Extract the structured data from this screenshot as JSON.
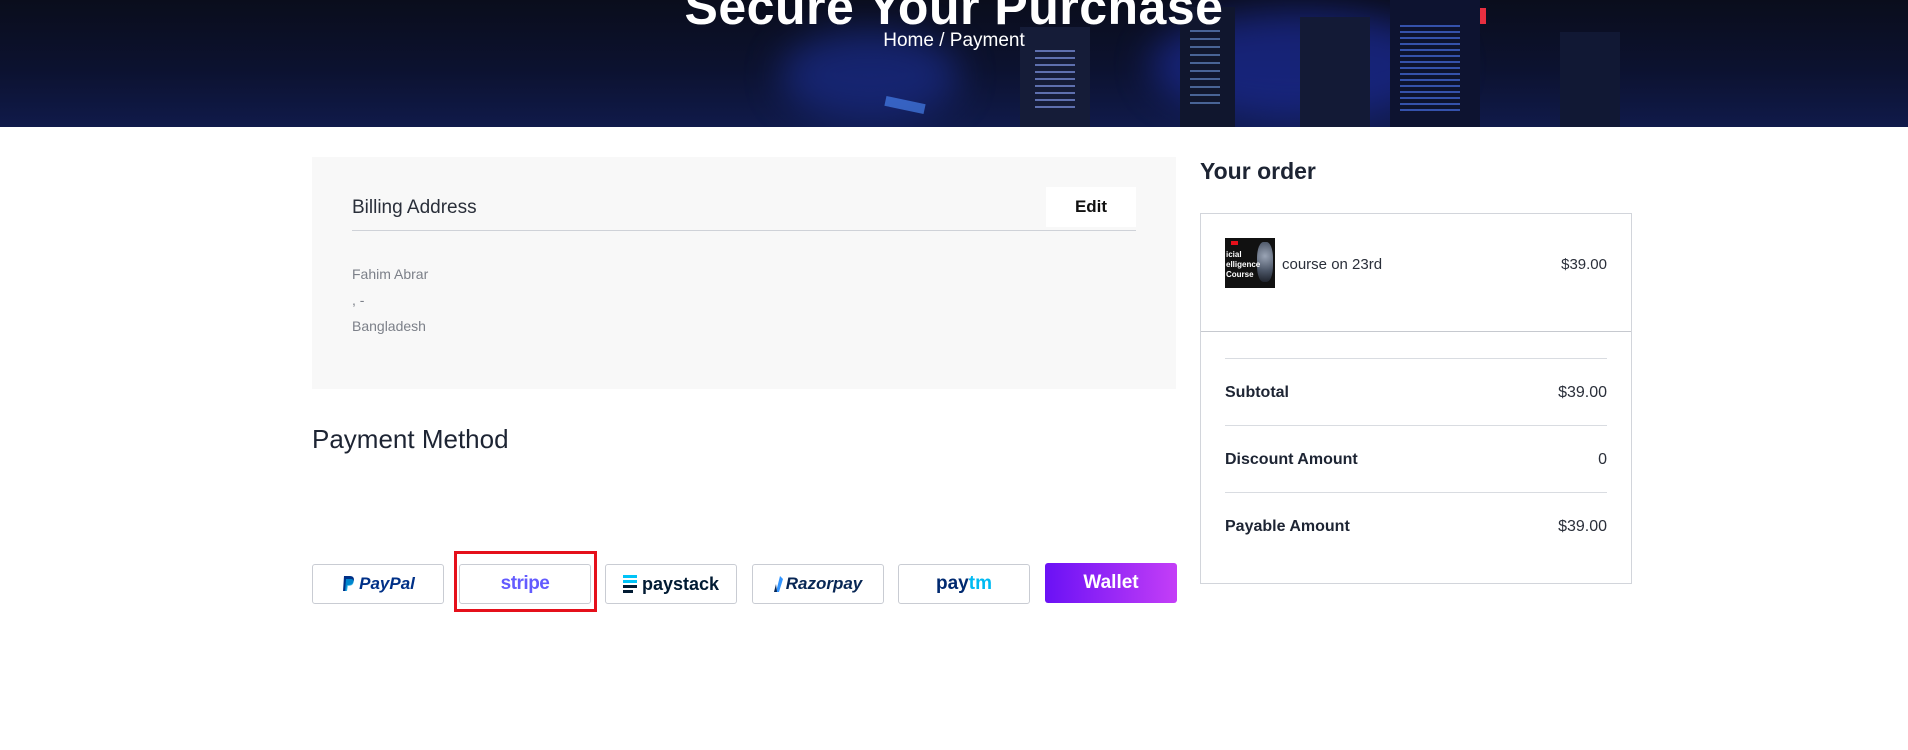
{
  "header": {
    "title": "Secure Your Purchase",
    "breadcrumb": "Home / Payment"
  },
  "billing": {
    "title": "Billing Address",
    "edit_label": "Edit",
    "name": "Fahim Abrar",
    "line2": ", -",
    "country": "Bangladesh"
  },
  "payment": {
    "title": "Payment Method",
    "methods": {
      "paypal": "PayPal",
      "stripe": "stripe",
      "paystack": "paystack",
      "razorpay": "Razorpay",
      "paytm": "paytm",
      "wallet": "Wallet"
    },
    "highlighted": "stripe"
  },
  "order": {
    "title": "Your order",
    "item": {
      "thumb_text": "icial\nelligence\nCourse",
      "name": "course on 23rd",
      "price": "$39.00"
    },
    "subtotal_label": "Subtotal",
    "subtotal_value": "$39.00",
    "discount_label": "Discount Amount",
    "discount_value": "0",
    "payable_label": "Payable Amount",
    "payable_value": "$39.00"
  },
  "colors": {
    "accent_highlight": "#e5101b",
    "wallet_gradient_start": "#6a11f5",
    "wallet_gradient_end": "#c43ef7",
    "paypal_dark": "#003087",
    "paypal_light": "#009cde",
    "stripe": "#635bff",
    "paystack": "#011b33",
    "razorpay": "#072654",
    "paytm_dark": "#002970",
    "paytm_light": "#00baf2"
  }
}
